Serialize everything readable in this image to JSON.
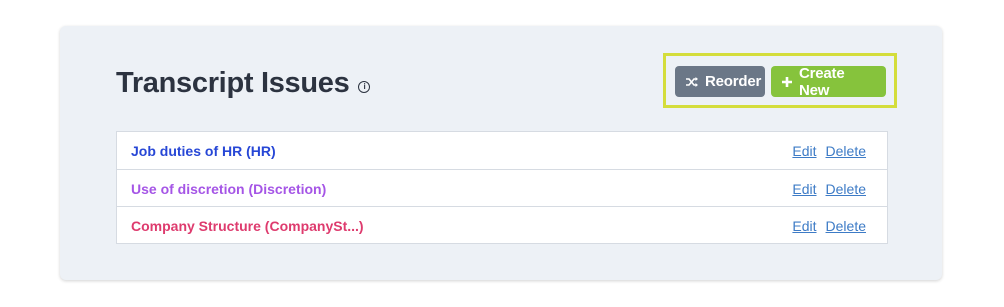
{
  "page": {
    "title": "Transcript Issues",
    "info_glyph": "i"
  },
  "toolbar": {
    "reorder_label": "Reorder",
    "create_label": "Create New"
  },
  "issues": [
    {
      "label": "Job duties of HR (HR)",
      "color": "#2747d6",
      "edit_label": "Edit",
      "delete_label": "Delete"
    },
    {
      "label": "Use of discretion (Discretion)",
      "color": "#a555e6",
      "edit_label": "Edit",
      "delete_label": "Delete"
    },
    {
      "label": "Company Structure (CompanySt...)",
      "color": "#de3b6e",
      "edit_label": "Edit",
      "delete_label": "Delete"
    }
  ],
  "colors": {
    "reorder_bg": "#6b7787",
    "create_bg": "#86c33c",
    "highlight": "#d4dd3b",
    "link": "#3d7bc6"
  }
}
